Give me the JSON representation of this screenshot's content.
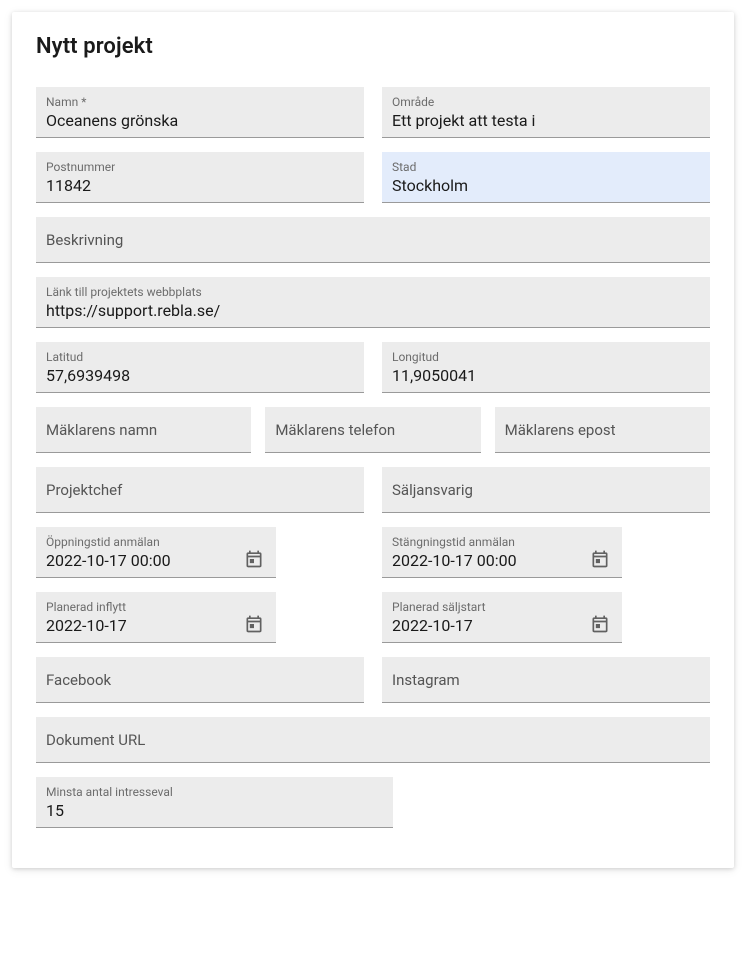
{
  "title": "Nytt projekt",
  "fields": {
    "name": {
      "label": "Namn *",
      "value": "Oceanens grönska"
    },
    "area": {
      "label": "Område",
      "value": "Ett projekt att testa i"
    },
    "postcode": {
      "label": "Postnummer",
      "value": "11842"
    },
    "city": {
      "label": "Stad",
      "value": "Stockholm"
    },
    "description": {
      "label": "Beskrivning"
    },
    "website": {
      "label": "Länk till projektets webbplats",
      "value": "https://support.rebla.se/"
    },
    "lat": {
      "label": "Latitud",
      "value": "57,6939498"
    },
    "lng": {
      "label": "Longitud",
      "value": "11,9050041"
    },
    "broker_name": {
      "label": "Mäklarens namn"
    },
    "broker_phone": {
      "label": "Mäklarens telefon"
    },
    "broker_email": {
      "label": "Mäklarens epost"
    },
    "project_mgr": {
      "label": "Projektchef"
    },
    "sales_lead": {
      "label": "Säljansvarig"
    },
    "open_time": {
      "label": "Öppningstid anmälan",
      "value": "2022-10-17 00:00"
    },
    "close_time": {
      "label": "Stängningstid anmälan",
      "value": "2022-10-17 00:00"
    },
    "move_in": {
      "label": "Planerad inflytt",
      "value": "2022-10-17"
    },
    "sale_start": {
      "label": "Planerad säljstart",
      "value": "2022-10-17"
    },
    "facebook": {
      "label": "Facebook"
    },
    "instagram": {
      "label": "Instagram"
    },
    "doc_url": {
      "label": "Dokument URL"
    },
    "min_interest": {
      "label": "Minsta antal intresseval",
      "value": "15"
    }
  }
}
